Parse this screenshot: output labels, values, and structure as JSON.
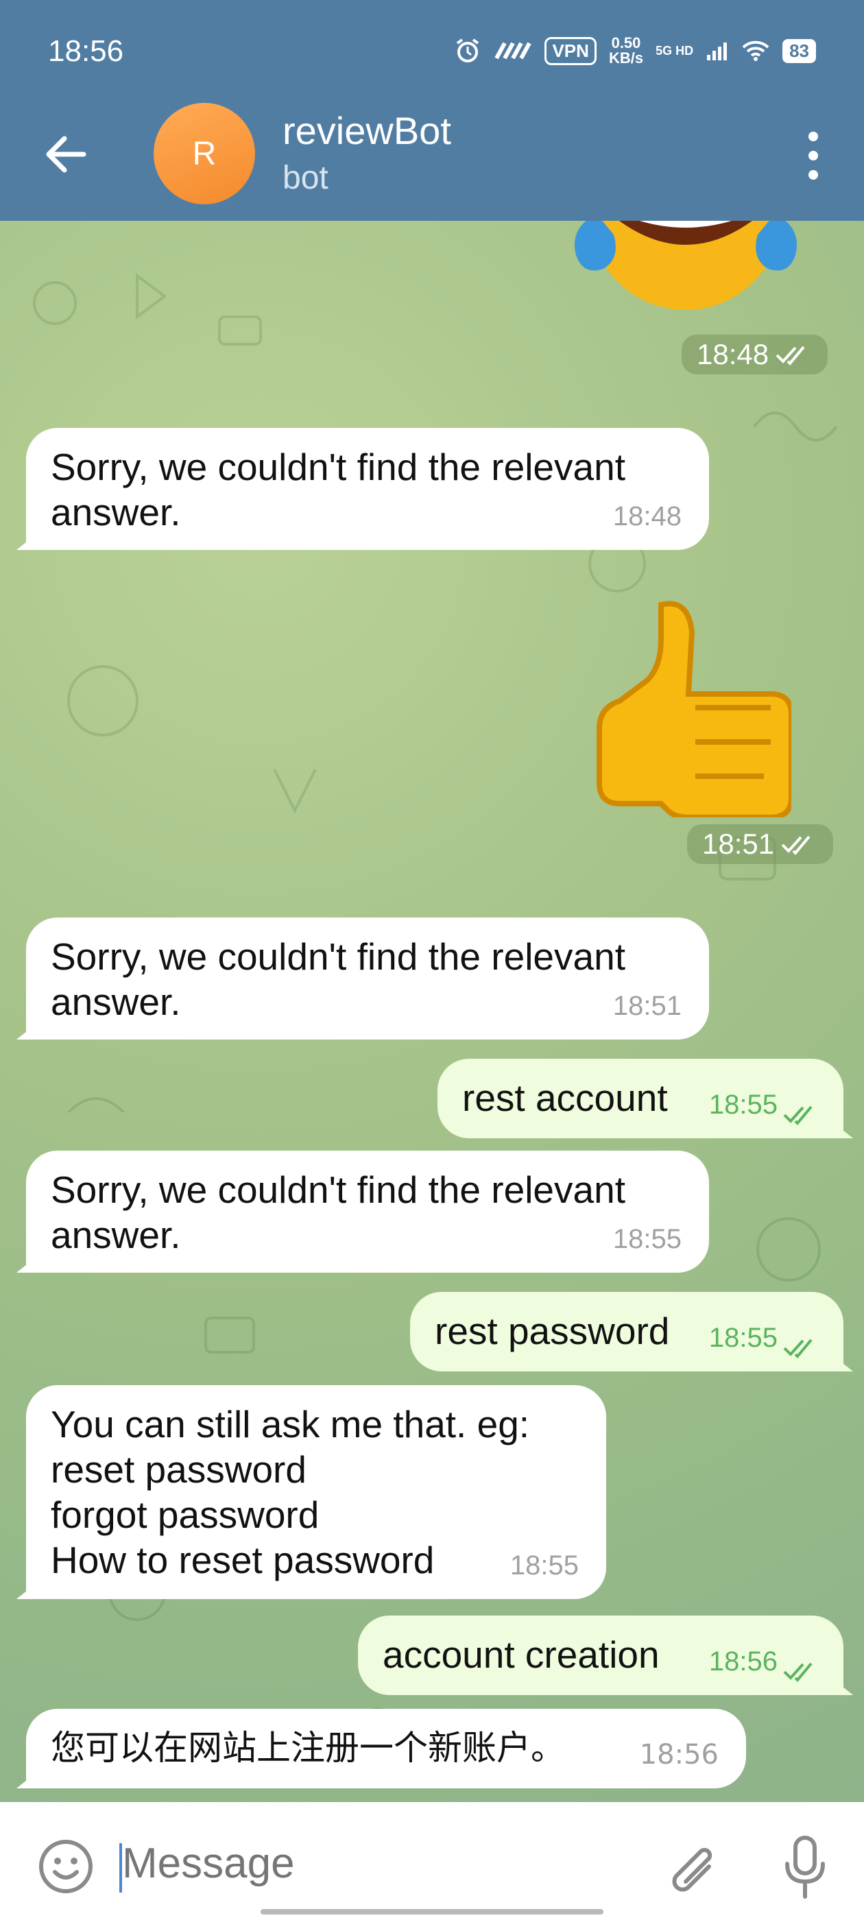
{
  "status_bar": {
    "time": "18:56",
    "vpn": "VPN",
    "speed_value": "0.50",
    "speed_unit": "KB/s",
    "network": "5G HD",
    "battery": "83"
  },
  "header": {
    "avatar_letter": "R",
    "title": "reviewBot",
    "subtitle": "bot"
  },
  "messages": [
    {
      "type": "sticker",
      "emoji": "😂",
      "time": "18:48"
    },
    {
      "type": "incoming",
      "text": "Sorry, we couldn't find the relevant\nanswer.",
      "time": "18:48"
    },
    {
      "type": "sticker",
      "emoji": "👍",
      "time": "18:51"
    },
    {
      "type": "incoming",
      "text": "Sorry, we couldn't find the relevant\nanswer.",
      "time": "18:51"
    },
    {
      "type": "outgoing",
      "text": "rest account",
      "time": "18:55"
    },
    {
      "type": "incoming",
      "text": "Sorry, we couldn't find the relevant\nanswer.",
      "time": "18:55"
    },
    {
      "type": "outgoing",
      "text": "rest password",
      "time": "18:55"
    },
    {
      "type": "incoming",
      "text": "You can still ask me that. eg:\nreset password\nforgot password\nHow to reset password",
      "time": "18:55"
    },
    {
      "type": "outgoing",
      "text": "account creation",
      "time": "18:56"
    },
    {
      "type": "incoming",
      "text": "您可以在网站上注册一个新账户。",
      "time": "18:56"
    }
  ],
  "input": {
    "placeholder": "Message"
  },
  "colors": {
    "header": "#527da3",
    "outgoing_bubble": "#effcde",
    "incoming_bubble": "#ffffff",
    "check": "#5bb35e"
  }
}
